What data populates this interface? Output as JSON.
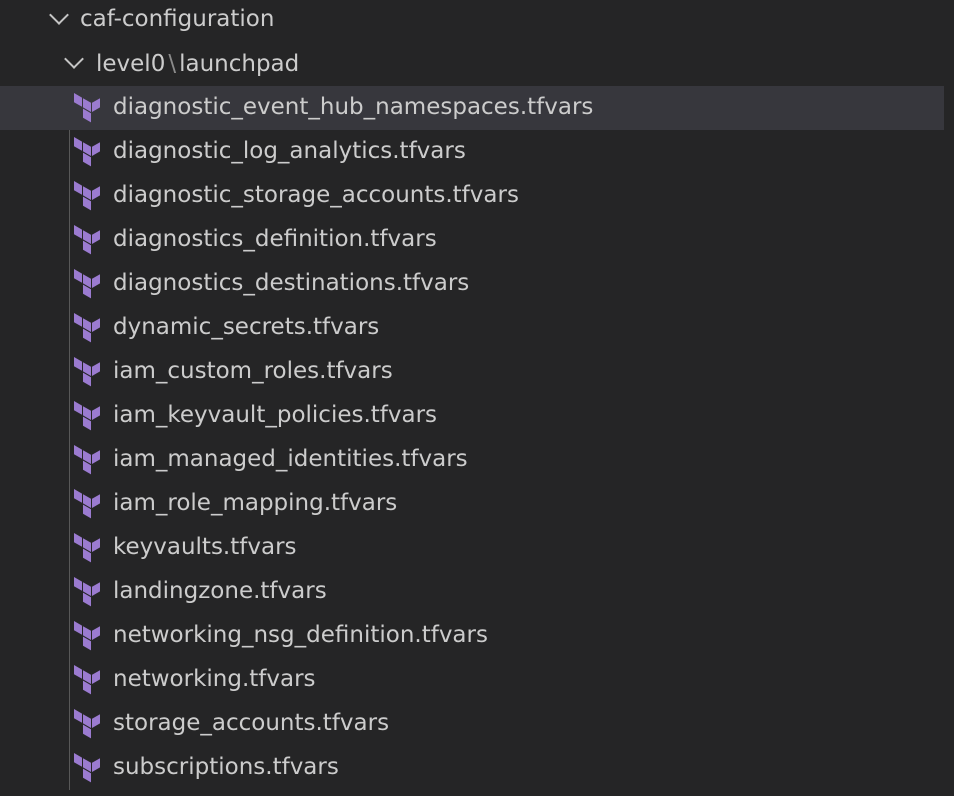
{
  "explorer": {
    "root_folder": {
      "label": "caf-configuration",
      "expanded": true
    },
    "subfolder": {
      "segments": [
        "level0",
        "launchpad"
      ],
      "separator": "\\",
      "expanded": true
    },
    "icon_color": "#9b7bd0",
    "selected_background": "#37373d",
    "files": [
      {
        "label": "diagnostic_event_hub_namespaces.tfvars",
        "icon": "terraform-icon",
        "selected": true
      },
      {
        "label": "diagnostic_log_analytics.tfvars",
        "icon": "terraform-icon",
        "selected": false
      },
      {
        "label": "diagnostic_storage_accounts.tfvars",
        "icon": "terraform-icon",
        "selected": false
      },
      {
        "label": "diagnostics_definition.tfvars",
        "icon": "terraform-icon",
        "selected": false
      },
      {
        "label": "diagnostics_destinations.tfvars",
        "icon": "terraform-icon",
        "selected": false
      },
      {
        "label": "dynamic_secrets.tfvars",
        "icon": "terraform-icon",
        "selected": false
      },
      {
        "label": "iam_custom_roles.tfvars",
        "icon": "terraform-icon",
        "selected": false
      },
      {
        "label": "iam_keyvault_policies.tfvars",
        "icon": "terraform-icon",
        "selected": false
      },
      {
        "label": "iam_managed_identities.tfvars",
        "icon": "terraform-icon",
        "selected": false
      },
      {
        "label": "iam_role_mapping.tfvars",
        "icon": "terraform-icon",
        "selected": false
      },
      {
        "label": "keyvaults.tfvars",
        "icon": "terraform-icon",
        "selected": false
      },
      {
        "label": "landingzone.tfvars",
        "icon": "terraform-icon",
        "selected": false
      },
      {
        "label": "networking_nsg_definition.tfvars",
        "icon": "terraform-icon",
        "selected": false
      },
      {
        "label": "networking.tfvars",
        "icon": "terraform-icon",
        "selected": false
      },
      {
        "label": "storage_accounts.tfvars",
        "icon": "terraform-icon",
        "selected": false
      },
      {
        "label": "subscriptions.tfvars",
        "icon": "terraform-icon",
        "selected": false
      }
    ]
  }
}
